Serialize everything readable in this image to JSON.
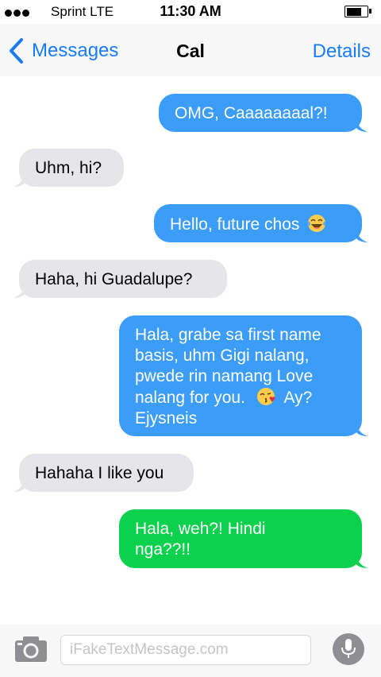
{
  "status_bar": {
    "carrier": "Sprint  LTE",
    "time": "11:30 AM"
  },
  "nav": {
    "back_label": "Messages",
    "title": "Cal",
    "details_label": "Details"
  },
  "messages": [
    {
      "direction": "outgoing",
      "text": "OMG, Caaaaaaaal?!"
    },
    {
      "direction": "incoming",
      "text": "Uhm, hi?"
    },
    {
      "direction": "outgoing",
      "text": "Hello, future chos",
      "emoji": "laughing-tears-emoji"
    },
    {
      "direction": "incoming",
      "text": "Haha, hi Guadalupe?"
    },
    {
      "direction": "outgoing",
      "lines": [
        "Hala, grabe sa first name",
        "basis, uhm Gigi nalang,",
        "pwede rin namang Love",
        "nalang for you.",
        "Ay?",
        "Ejysneis"
      ],
      "emoji": "kissing-heart-emoji"
    },
    {
      "direction": "incoming",
      "text": "Hahaha I like you"
    },
    {
      "direction": "outgoing-sms",
      "lines": [
        "Hala, weh?! Hindi",
        "nga??!!"
      ]
    }
  ],
  "input": {
    "placeholder": "iFakeTextMessage.com"
  },
  "colors": {
    "imessage_blue": "#3b9df8",
    "sms_green": "#0bd14c",
    "incoming_gray": "#e5e5ea",
    "link_blue": "#1a7cf5"
  }
}
